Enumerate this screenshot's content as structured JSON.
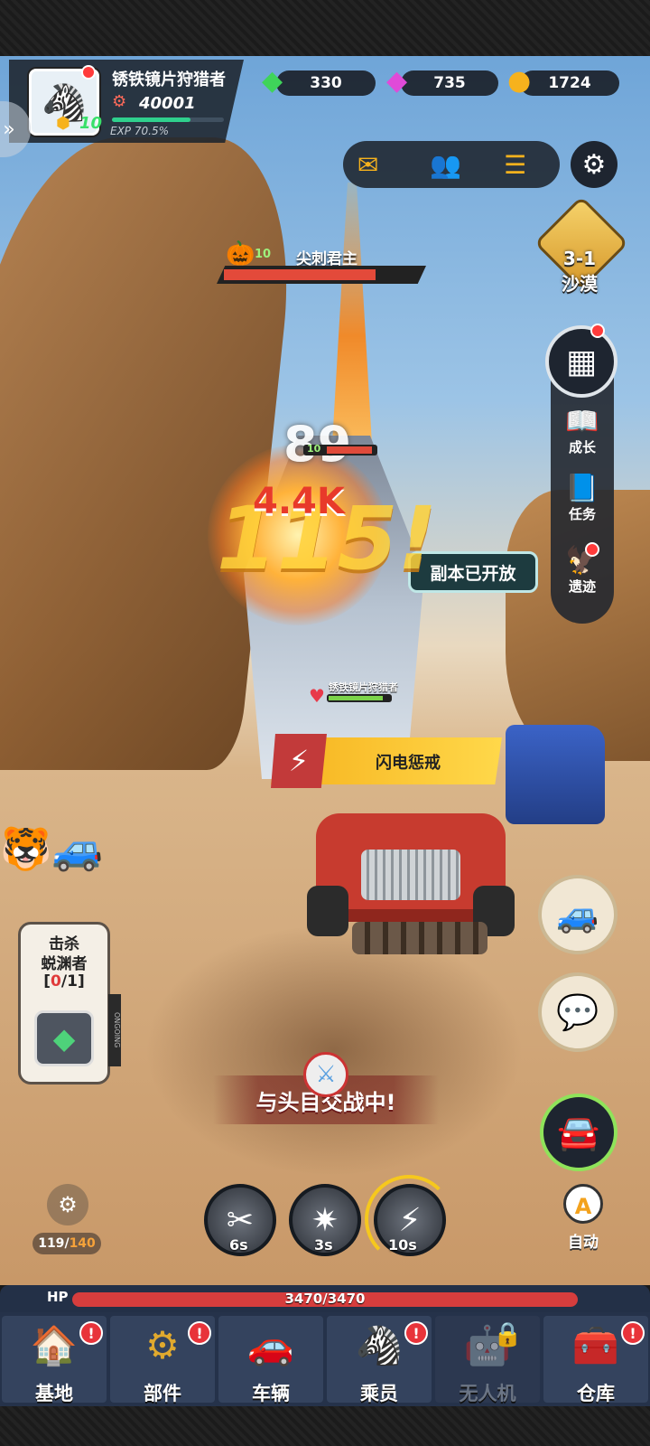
{
  "player": {
    "name": "锈铁镜片狩猎者",
    "power": "40001",
    "level": "10",
    "exp_label": "EXP",
    "exp_percent": "70.5%",
    "exp_fraction": 0.705
  },
  "currency": {
    "green_gem": "330",
    "pink_gem": "735",
    "gold": "1724"
  },
  "stage": {
    "id": "3-1",
    "name": "沙漠"
  },
  "boss": {
    "level": "10",
    "name": "尖刺君主",
    "hp_fraction": 0.75
  },
  "damage": {
    "hit1": "89",
    "hit2": "4.4K",
    "hit3": "115!",
    "mini_level": "10"
  },
  "right_panel": {
    "items": [
      {
        "label": "成长"
      },
      {
        "label": "任务"
      },
      {
        "label": "遗迹"
      }
    ]
  },
  "dungeon_notice": "副本已开放",
  "player_tag": "锈铁镜片狩猎者",
  "skill_banner": "闪电惩戒",
  "quest": {
    "line1": "击杀",
    "line2": "蜕渊者",
    "progress_open": "[",
    "progress_current": "0",
    "progress_sep": "/",
    "progress_total": "1",
    "progress_close": "]",
    "tab": "ONGOING"
  },
  "boss_fight": "与头目交战中!",
  "ammo": {
    "current": "119",
    "max": "140"
  },
  "skills": [
    {
      "cooldown": "6s"
    },
    {
      "cooldown": "3s"
    },
    {
      "cooldown": "10s"
    }
  ],
  "auto": {
    "icon": "A",
    "label": "自动"
  },
  "hp": {
    "label": "HP",
    "value": "3470/3470",
    "fraction": 1.0
  },
  "nav": [
    {
      "label": "基地",
      "icon": "🏠",
      "alert": "!"
    },
    {
      "label": "部件",
      "icon": "⚙",
      "alert": "!"
    },
    {
      "label": "车辆",
      "icon": "🚗",
      "alert": ""
    },
    {
      "label": "乘员",
      "icon": "🦓",
      "alert": "!"
    },
    {
      "label": "无人机",
      "icon": "🤖",
      "alert": ""
    },
    {
      "label": "仓库",
      "icon": "🧰",
      "alert": "!"
    }
  ],
  "colors": {
    "accent_green": "#2fd08d",
    "gold": "#f6b21d",
    "danger": "#e34a3a",
    "nav_bg": "#25324a"
  }
}
